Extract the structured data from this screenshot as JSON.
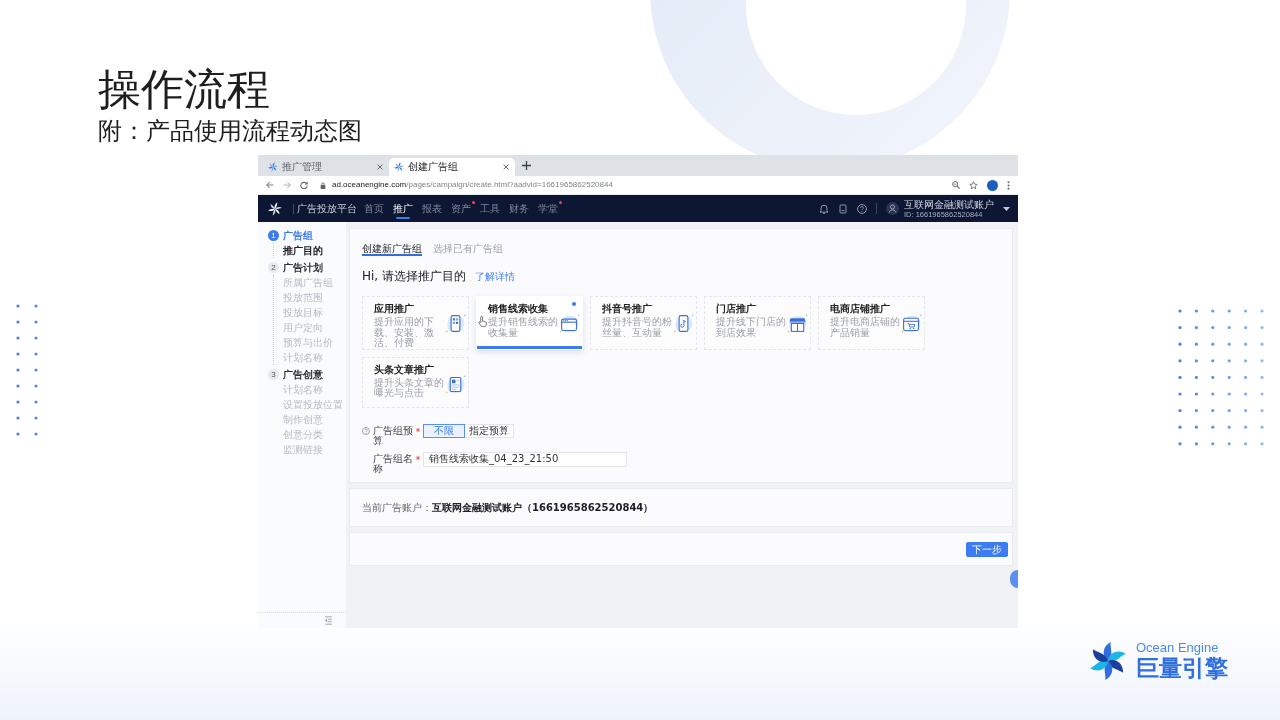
{
  "slide": {
    "title": "操作流程",
    "subtitle": "附：产品使用流程动态图"
  },
  "browser": {
    "tabs": [
      {
        "label": "推广管理",
        "selected": false
      },
      {
        "label": "创建广告组",
        "selected": true
      }
    ],
    "url": {
      "host": "ad.oceanengine.com",
      "path": "/pages/campaign/create.html?aadvid=1661965862520844"
    }
  },
  "app": {
    "brand": "广告投放平台",
    "nav": [
      {
        "label": "首页",
        "selected": false,
        "badge": false
      },
      {
        "label": "推广",
        "selected": true,
        "badge": false
      },
      {
        "label": "报表",
        "selected": false,
        "badge": false
      },
      {
        "label": "资产",
        "selected": false,
        "badge": true
      },
      {
        "label": "工具",
        "selected": false,
        "badge": false
      },
      {
        "label": "财务",
        "selected": false,
        "badge": false
      },
      {
        "label": "学堂",
        "selected": false,
        "badge": true
      }
    ],
    "account": {
      "name": "互联网金融测试账户",
      "id": "ID: 1661965862520844"
    }
  },
  "sidebar": {
    "steps": [
      {
        "number": "1",
        "label": "广告组",
        "selected": true,
        "children": [
          {
            "label": "推广目的",
            "selected": true
          }
        ]
      },
      {
        "number": "2",
        "label": "广告计划",
        "selected": false,
        "children": [
          {
            "label": "所属广告组",
            "selected": false
          },
          {
            "label": "投放范围",
            "selected": false
          },
          {
            "label": "投放目标",
            "selected": false
          },
          {
            "label": "用户定向",
            "selected": false
          },
          {
            "label": "预算与出价",
            "selected": false
          },
          {
            "label": "计划名称",
            "selected": false
          }
        ]
      },
      {
        "number": "3",
        "label": "广告创意",
        "selected": false,
        "children": [
          {
            "label": "计划名称",
            "selected": false
          },
          {
            "label": "设置投放位置",
            "selected": false
          },
          {
            "label": "制作创意",
            "selected": false
          },
          {
            "label": "创意分类",
            "selected": false
          },
          {
            "label": "监测链接",
            "selected": false
          }
        ]
      }
    ]
  },
  "content": {
    "tabs": [
      {
        "label": "创建新广告组",
        "selected": true
      },
      {
        "label": "选择已有广告组",
        "selected": false
      }
    ],
    "heading": "Hi, 请选择推广目的",
    "link": "了解详情",
    "purposes": [
      {
        "kind": "app",
        "title": "应用推广",
        "description": "提升应用的下载、安装、激活、付费",
        "selected": false
      },
      {
        "kind": "leads",
        "title": "销售线索收集",
        "description": "提升销售线索的收集量",
        "selected": true
      },
      {
        "kind": "douyin",
        "title": "抖音号推广",
        "description": "提升抖音号的粉丝量、互动量",
        "selected": false
      },
      {
        "kind": "store",
        "title": "门店推广",
        "description": "提升线下门店的到店效果",
        "selected": false
      },
      {
        "kind": "shop",
        "title": "电商店铺推广",
        "description": "提升电商店铺的产品销量",
        "selected": false
      },
      {
        "kind": "article",
        "title": "头条文章推广",
        "description": "提升头条文章的曝光与点击",
        "selected": false
      }
    ],
    "form": [
      {
        "kind": "choice",
        "label": "广告组预算",
        "required": true,
        "help": true,
        "options": [
          {
            "label": "不限",
            "selected": true
          },
          {
            "label": "指定预算",
            "selected": false
          }
        ]
      },
      {
        "kind": "text",
        "label": "广告组名称",
        "required": true,
        "help": false,
        "value": "销售线索收集_04_23_21:50"
      }
    ],
    "account_line": "当前广告账户：**互联网金融测试账户（1661965862520844）**",
    "next_button": "下一步"
  },
  "logo": {
    "latin": "Ocean Engine",
    "chinese": "巨量引擎"
  }
}
